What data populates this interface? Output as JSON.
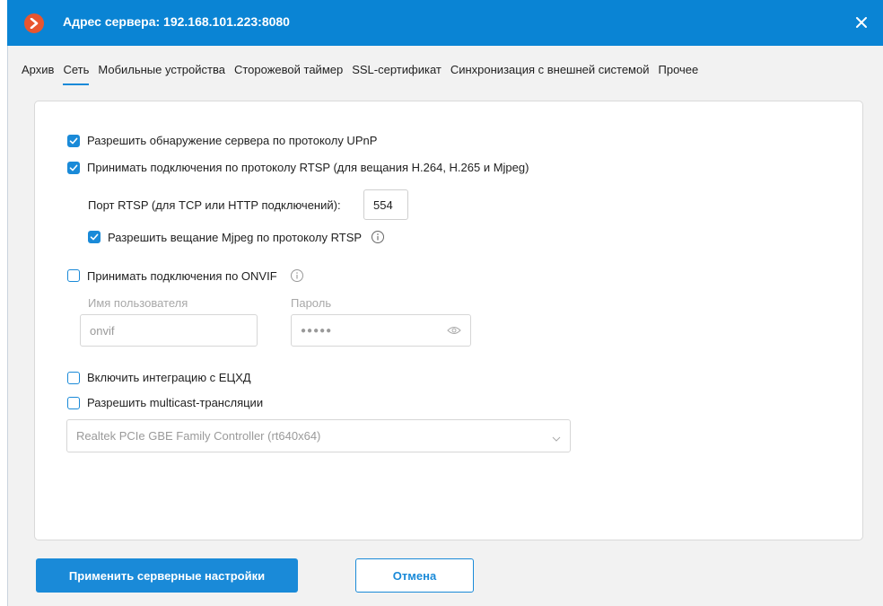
{
  "window": {
    "title": "Адрес сервера: 192.168.101.223:8080",
    "accent_color": "#0a84d4",
    "logo_color": "#e8552f",
    "logo_icon": "app-logo-icon",
    "close_icon": "close-icon"
  },
  "tabs": [
    {
      "label": "Архив",
      "active": false
    },
    {
      "label": "Сеть",
      "active": true
    },
    {
      "label": "Мобильные устройства",
      "active": false
    },
    {
      "label": "Сторожевой таймер",
      "active": false
    },
    {
      "label": "SSL-сертификат",
      "active": false
    },
    {
      "label": "Синхронизация с внешней системой",
      "active": false
    },
    {
      "label": "Прочее",
      "active": false
    }
  ],
  "network": {
    "upnp": {
      "label": "Разрешить обнаружение сервера по протоколу UPnP",
      "checked": true
    },
    "rtsp": {
      "label": "Принимать подключения по протоколу RTSP (для вещания H.264, H.265 и Mjpeg)",
      "checked": true
    },
    "rtsp_port": {
      "label": "Порт RTSP (для TCP или HTTP подключений):",
      "value": "554"
    },
    "mjpeg_rtsp": {
      "label": "Разрешить вещание Mjpeg по протоколу RTSP",
      "checked": true,
      "info_icon": "info-icon"
    },
    "onvif": {
      "label": "Принимать подключения по ONVIF",
      "checked": false,
      "info_icon": "info-icon",
      "username_label": "Имя пользователя",
      "username_value": "onvif",
      "password_label": "Пароль",
      "password_value": "●●●●●",
      "eye_icon": "eye-icon"
    },
    "ecchd": {
      "label": "Включить интеграцию с ЕЦХД",
      "checked": false
    },
    "multicast": {
      "label": "Разрешить multicast-трансляции",
      "checked": false
    },
    "adapter_select": {
      "value": "Realtek PCIe GBE Family Controller (rt640x64)",
      "chevron_icon": "chevron-down-icon"
    }
  },
  "buttons": {
    "apply": "Применить серверные настройки",
    "cancel": "Отмена"
  }
}
